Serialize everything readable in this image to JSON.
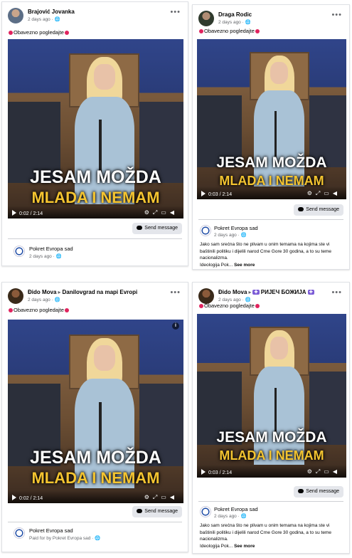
{
  "posts": [
    {
      "author": "Brajović Jovanka",
      "meta": "2 days ago · 🌐",
      "caption": "Obavezno pogledajte",
      "video": {
        "line1": "JESAM MOŽDA",
        "line2": "MLADA I NEMAM",
        "time": "0:02 / 2:14"
      },
      "send_label": "Send message",
      "page_name": "Pokret Evropa sad",
      "page_meta": "2 days ago · 🌐"
    },
    {
      "author": "Draga Rodic",
      "meta": "2 days ago · 🌐",
      "caption": "Obavezno pogledajte",
      "video": {
        "line1": "JESAM MOŽDA",
        "line2": "MLADA I NEMAM",
        "time": "0:03 / 2:14"
      },
      "send_label": "Send message",
      "page_name": "Pokret Evropa sad",
      "page_meta": "2 days ago · 🌐",
      "body": "Jako sam srećna što ne plivam u onim temama na kojima ste vi baštinili politiku i dijelili narod Crne Gore 30 godina, a to su teme nacionalizma.",
      "body_end": "Ideologija Pok...",
      "see_more": "See more"
    },
    {
      "author": "Đido Mova",
      "author_target": "Danilovgrad na mapi Evropi",
      "meta": "2 days ago · 🌐",
      "caption": "Obavezno pogledajte",
      "video": {
        "line1": "JESAM MOŽDA",
        "line2": "MLADA I NEMAM",
        "time": "0:02 / 2:14"
      },
      "send_label": "Send message",
      "page_name": "Pokret Evropa sad",
      "page_meta": "Paid for by Pokret Evropa sad · 🌐"
    },
    {
      "author": "Đido Mova",
      "author_target": "РИЈЕЧ БОЖИЈА",
      "meta": "2 days ago · 🌐",
      "caption": "Obavezno pogledajte",
      "video": {
        "line1": "JESAM MOŽDA",
        "line2": "MLADA I NEMAM",
        "time": "0:03 / 2:14"
      },
      "send_label": "Send message",
      "page_name": "Pokret Evropa sad",
      "page_meta": "2 days ago · 🌐",
      "body": "Jako sam srećna što ne plivam u onim temama na kojima ste vi baštinili politiku i dijelili narod Crne Gore 30 godina, a to su teme nacionalizma.",
      "body_end": "Ideologija Pok...",
      "see_more": "See more"
    }
  ],
  "colors": {
    "caption_dot": "#e0245e",
    "subtitle_yellow": "#f4c430",
    "badge": "#7b5cd6"
  }
}
